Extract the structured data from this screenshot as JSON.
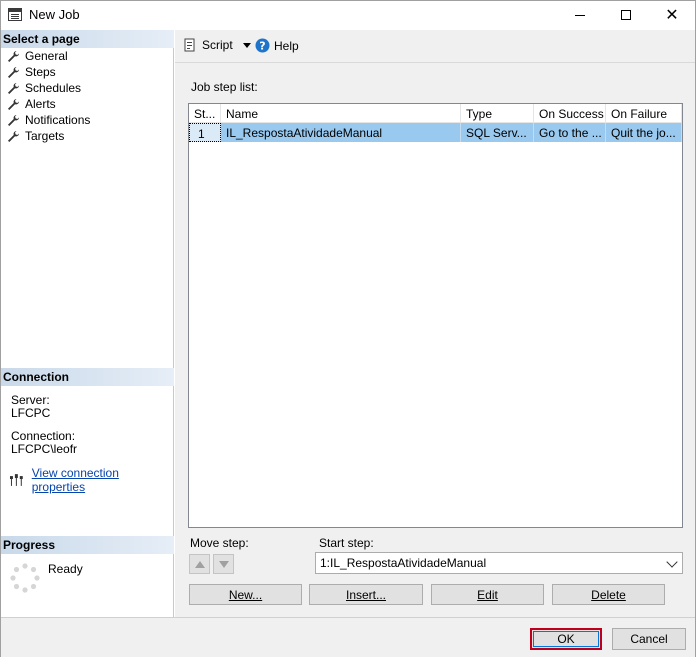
{
  "window": {
    "title": "New Job"
  },
  "left": {
    "select_page_header": "Select a page",
    "pages": [
      "General",
      "Steps",
      "Schedules",
      "Alerts",
      "Notifications",
      "Targets"
    ],
    "connection_header": "Connection",
    "server_label": "Server:",
    "server_value": "LFCPC",
    "connection_label": "Connection:",
    "connection_value": "LFCPC\\leofr",
    "view_connection_link": "View connection properties",
    "progress_header": "Progress",
    "progress_status": "Ready"
  },
  "toolbar": {
    "script_label": "Script",
    "help_label": "Help"
  },
  "main": {
    "job_step_list_label": "Job step list:",
    "columns": [
      "St...",
      "Name",
      "Type",
      "On Success",
      "On Failure"
    ],
    "rows": [
      [
        "1",
        "IL_RespostaAtividadeManual",
        "SQL Serv...",
        "Go to the ...",
        "Quit the jo..."
      ]
    ],
    "move_step_label": "Move step:",
    "start_step_label": "Start step:",
    "start_step_value": "1:IL_RespostaAtividadeManual",
    "buttons": {
      "new": "New...",
      "insert": "Insert...",
      "edit": "Edit",
      "delete": "Delete"
    }
  },
  "footer": {
    "ok": "OK",
    "cancel": "Cancel"
  },
  "colors": {
    "selected_row": "#99c9ef",
    "ok_highlight": "#c0001a",
    "link": "#0645ad",
    "help_icon": "#1e74c9"
  },
  "icons": [
    "window-icon",
    "wrench-icon",
    "script-icon",
    "help-icon",
    "connection-icon",
    "spinner-icon",
    "arrow-up-icon",
    "arrow-down-icon"
  ]
}
